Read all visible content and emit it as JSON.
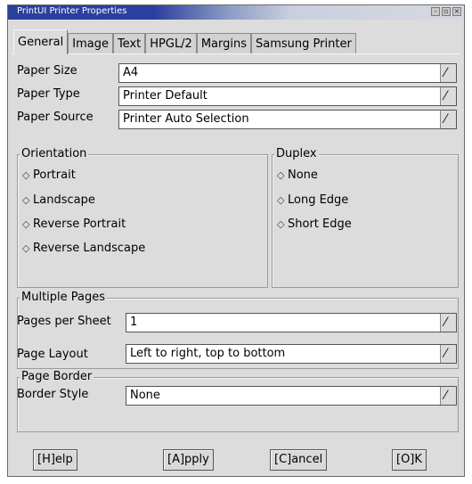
{
  "window": {
    "title": "PrintUI Printer Properties",
    "wm_buttons": [
      "-",
      "▫",
      "×"
    ]
  },
  "tabs": [
    {
      "label": "General",
      "active": true
    },
    {
      "label": "Image",
      "active": false
    },
    {
      "label": "Text",
      "active": false
    },
    {
      "label": "HPGL/2",
      "active": false
    },
    {
      "label": "Margins",
      "active": false
    },
    {
      "label": "Samsung Printer",
      "active": false
    }
  ],
  "paper": {
    "size_label": "Paper Size",
    "size_value": "A4",
    "type_label": "Paper Type",
    "type_value": "Printer Default",
    "source_label": "Paper Source",
    "source_value": "Printer Auto Selection"
  },
  "orientation": {
    "title": "Orientation",
    "options": [
      {
        "label": "Portrait",
        "selected": true
      },
      {
        "label": "Landscape",
        "selected": false
      },
      {
        "label": "Reverse Portrait",
        "selected": false
      },
      {
        "label": "Reverse Landscape",
        "selected": false
      }
    ]
  },
  "duplex": {
    "title": "Duplex",
    "options": [
      {
        "label": "None",
        "selected": true
      },
      {
        "label": "Long Edge",
        "selected": false
      },
      {
        "label": "Short Edge",
        "selected": false
      }
    ]
  },
  "multiple_pages": {
    "title": "Multiple Pages",
    "per_sheet_label": "Pages per Sheet",
    "per_sheet_value": "1",
    "layout_label": "Page Layout",
    "layout_value": "Left to right, top to bottom"
  },
  "page_border": {
    "title": "Page Border",
    "style_label": "Border Style",
    "style_value": "None"
  },
  "buttons": {
    "help": "[H]elp",
    "apply": "[A]pply",
    "cancel": "[C]ancel",
    "ok": "[O]K"
  },
  "icons": {
    "dropdown": "dropdown-arrow-icon",
    "radio_on": "radio-selected-icon",
    "radio_off": "radio-unselected-icon"
  }
}
